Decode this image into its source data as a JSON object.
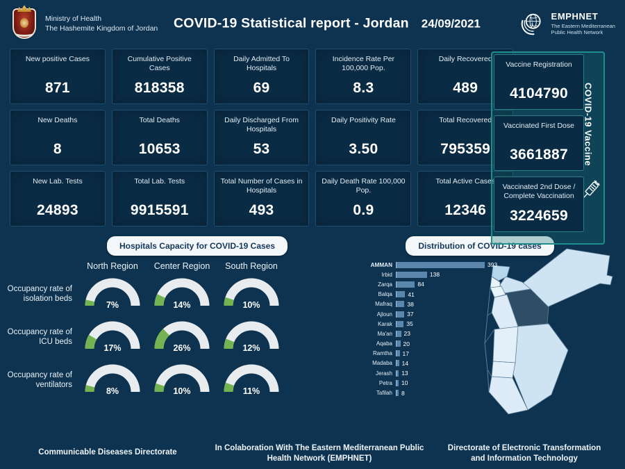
{
  "header": {
    "ministry_line1": "Ministry of Health",
    "ministry_line2": "The Hashemite Kingdom of Jordan",
    "title": "COVID-19 Statistical report - Jordan",
    "date": "24/09/2021",
    "emphnet_name": "EMPHNET",
    "emphnet_sub1": "The Eastern Mediterranean",
    "emphnet_sub2": "Public Health Network",
    "emblem_icon": "jordan-coat-of-arms",
    "emphnet_icon": "globe-logo-icon"
  },
  "stats": {
    "rows": [
      [
        {
          "label": "New positive Cases",
          "value": "871"
        },
        {
          "label": "Cumulative  Positive Cases",
          "value": "818358"
        },
        {
          "label": "Daily Admitted To Hospitals",
          "value": "69"
        },
        {
          "label": "Incidence Rate Per 100,000 Pop.",
          "value": "8.3"
        },
        {
          "label": "Daily Recovered",
          "value": "489"
        }
      ],
      [
        {
          "label": "New Deaths",
          "value": "8"
        },
        {
          "label": "Total Deaths",
          "value": "10653"
        },
        {
          "label": "Daily Discharged From Hospitals",
          "value": "53"
        },
        {
          "label": "Daily Positivity Rate",
          "value": "3.50"
        },
        {
          "label": "Total Recovered",
          "value": "795359"
        }
      ],
      [
        {
          "label": "New Lab. Tests",
          "value": "24893"
        },
        {
          "label": "Total Lab. Tests",
          "value": "9915591"
        },
        {
          "label": "Total Number of Cases in Hospitals",
          "value": "493"
        },
        {
          "label": "Daily Death Rate 100,000 Pop.",
          "value": "0.9"
        },
        {
          "label": "Total Active Cases",
          "value": "12346"
        }
      ]
    ]
  },
  "vaccine_panel": {
    "vertical_label": "COVID-19 Vaccine",
    "syringe_icon": "syringe-icon",
    "accent_color": "#1f8f8c",
    "cards": [
      {
        "label": "Vaccine Registration",
        "value": "4104790"
      },
      {
        "label": "Vaccinated First Dose",
        "value": "3661887"
      },
      {
        "label": "Vaccinated 2nd Dose / Complete Vaccination",
        "value": "3224659"
      }
    ]
  },
  "hospitals": {
    "title": "Hospitals Capacity for COVID-19 Cases",
    "regions": [
      "North Region",
      "Center Region",
      "South Region"
    ],
    "gauge_track_color": "#e8ecef",
    "gauge_fill_color": "#74b352",
    "rows": [
      {
        "label": "Occupancy rate of isolation beds",
        "values": [
          "7%",
          "14%",
          "10%"
        ],
        "numeric": [
          7,
          14,
          10
        ]
      },
      {
        "label": "Occupancy rate of ICU beds",
        "values": [
          "17%",
          "26%",
          "12%"
        ],
        "numeric": [
          17,
          26,
          12
        ]
      },
      {
        "label": "Occupancy rate of ventilators",
        "values": [
          "8%",
          "10%",
          "11%"
        ],
        "numeric": [
          8,
          10,
          11
        ]
      }
    ]
  },
  "distribution": {
    "title": "Distribution of COVID-19 cases",
    "bar_color": "#5b87ad",
    "map_icon": "jordan-map"
  },
  "chart_data": {
    "type": "bar",
    "title": "Distribution of COVID-19 cases",
    "orientation": "horizontal",
    "xlabel": "",
    "ylabel": "",
    "categories": [
      "AMMAN",
      "Irbid",
      "Zarqa",
      "Balqa",
      "Mafraq",
      "Ajloun",
      "Karak",
      "Ma'an",
      "Aqaba",
      "Ramtha",
      "Madaba",
      "Jerash",
      "Petra",
      "Tafilah"
    ],
    "values": [
      393,
      138,
      84,
      41,
      38,
      37,
      35,
      23,
      20,
      17,
      14,
      13,
      10,
      8
    ],
    "xlim": [
      0,
      393
    ],
    "grid": false,
    "legend": false
  },
  "footer": {
    "col1": "Communicable Diseases Directorate",
    "col2_line1": "In Colaboration With The Eastern Mediterranean Public",
    "col2_line2": "Health Network (EMPHNET)",
    "col3_line1": "Directorate of Electronic Transformation",
    "col3_line2": "and  Information Technology"
  }
}
